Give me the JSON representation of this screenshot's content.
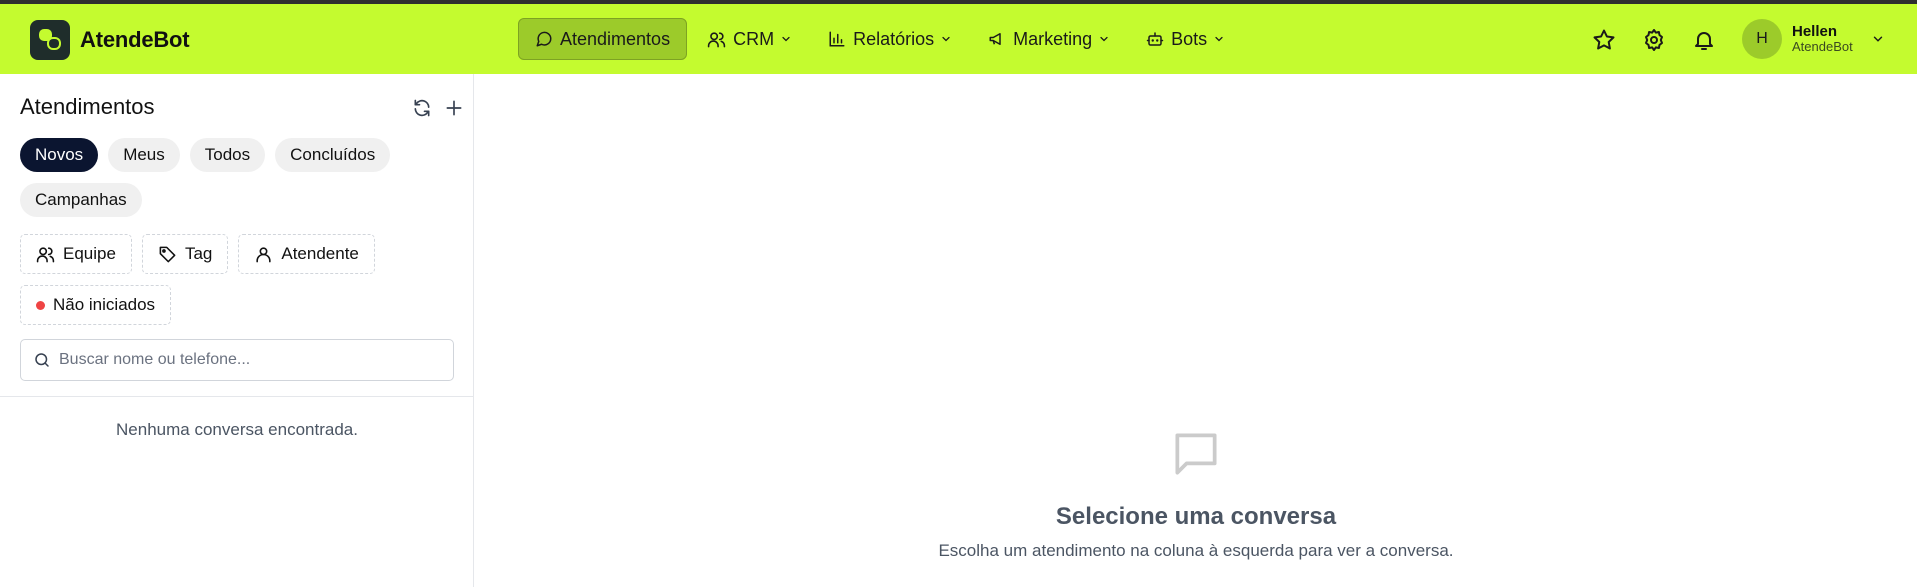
{
  "brand": {
    "name": "AtendeBot"
  },
  "nav": {
    "items": [
      {
        "label": "Atendimentos",
        "icon": "message-circle-icon",
        "active": true
      },
      {
        "label": "CRM",
        "icon": "users-icon"
      },
      {
        "label": "Relatórios",
        "icon": "bar-chart-icon"
      },
      {
        "label": "Marketing",
        "icon": "megaphone-icon"
      },
      {
        "label": "Bots",
        "icon": "bot-icon"
      }
    ]
  },
  "user": {
    "initial": "H",
    "name": "Hellen",
    "org": "AtendeBot"
  },
  "sidebar": {
    "title": "Atendimentos",
    "pills": [
      "Novos",
      "Meus",
      "Todos",
      "Concluídos",
      "Campanhas"
    ],
    "filters": {
      "team": "Equipe",
      "tag": "Tag",
      "agent": "Atendente",
      "not_started": "Não iniciados"
    },
    "search_placeholder": "Buscar nome ou telefone...",
    "empty_text": "Nenhuma conversa encontrada."
  },
  "main": {
    "empty_title": "Selecione uma conversa",
    "empty_subtitle": "Escolha um atendimento na coluna à esquerda para ver a conversa."
  },
  "colors": {
    "accent": "#c4fb2f",
    "active_nav": "#9ccb2a",
    "active_pill": "#0b1530",
    "dot": "#ef4444"
  }
}
